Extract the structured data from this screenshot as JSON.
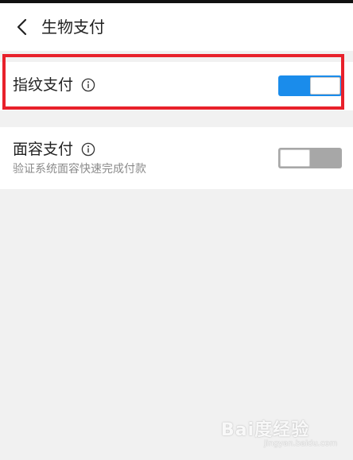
{
  "header": {
    "title": "生物支付",
    "back_icon": "chevron-left-icon"
  },
  "fingerprint": {
    "title": "指纹支付",
    "info_icon": "info-circle-icon",
    "toggle_on": true,
    "toggle_color": "#1a8ceb"
  },
  "face": {
    "title": "面容支付",
    "info_icon": "info-circle-icon",
    "subtitle": "验证系统面容快速完成付款",
    "toggle_on": false,
    "toggle_color": "#a7a7a7"
  },
  "annotation": {
    "highlight_color": "#e8212b"
  },
  "watermark": {
    "brand": "Bai度经验",
    "url": "jingyan.baidu.com"
  }
}
